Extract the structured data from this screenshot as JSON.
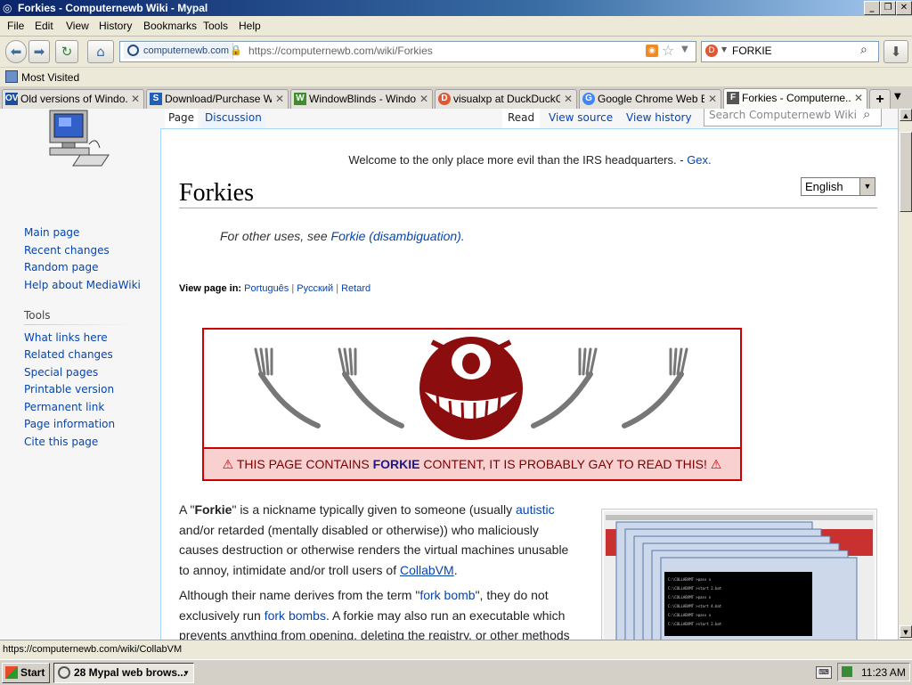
{
  "window": {
    "title": "Forkies - Computernewb Wiki - Mypal"
  },
  "menu": [
    "File",
    "Edit",
    "View",
    "History",
    "Bookmarks",
    "Tools",
    "Help"
  ],
  "nav": {
    "site_identity": "computernewb.com",
    "url": "https://computernewb.com/wiki/Forkies",
    "search_value": "FORKIE"
  },
  "bookmarks": {
    "most_visited": "Most Visited"
  },
  "tabs": [
    {
      "label": "Old versions of Windo...",
      "fav": "OV",
      "color": "#1a4fa0"
    },
    {
      "label": "Download/Purchase W...",
      "fav": "S",
      "color": "#1f5fb8"
    },
    {
      "label": "WindowBlinds - Windo...",
      "fav": "W",
      "color": "#3e8f2a"
    },
    {
      "label": "visualxp at DuckDuckGo",
      "fav": "D",
      "color": "#de5833"
    },
    {
      "label": "Google Chrome Web B...",
      "fav": "G",
      "color": "#4285f4"
    },
    {
      "label": "Forkies - Computerne...",
      "fav": "F",
      "color": "#555555"
    }
  ],
  "sidebar": {
    "nav_items": [
      "Main page",
      "Recent changes",
      "Random page",
      "Help about MediaWiki"
    ],
    "tools_heading": "Tools",
    "tools_items": [
      "What links here",
      "Related changes",
      "Special pages",
      "Printable version",
      "Permanent link",
      "Page information",
      "Cite this page"
    ]
  },
  "page_tabs": {
    "page": "Page",
    "discussion": "Discussion",
    "read": "Read",
    "view_source": "View source",
    "view_history": "View history",
    "search_placeholder": "Search Computernewb Wiki"
  },
  "article": {
    "sitenotice": "Welcome to the only place more evil than the IRS headquarters. -",
    "sitenotice_author": "Gex.",
    "title": "Forkies",
    "language": "English",
    "hatnote_prefix": "For other uses, see",
    "hatnote_link": "Forkie (disambiguation).",
    "view_in_label": "View page in:",
    "view_in_links": [
      "Português",
      "Русский",
      "Retard"
    ],
    "banner": {
      "pre": "THIS PAGE CONTAINS",
      "strong": "FORKIE",
      "post": "CONTENT, IT IS PROBABLY GAY TO READ THIS!"
    },
    "p1": {
      "a": "A \"",
      "b": "Forkie",
      "c": "\" is a nickname typically given to someone (usually",
      "d": "autistic",
      "e": "and/or retarded (mentally disabled or otherwise)) who maliciously causes destruction or otherwise renders the virtual machines unusable to annoy, intimidate and/or troll users of",
      "f": "CollabVM",
      "g": "."
    },
    "p2": {
      "a": "Although their name derives from the term \"",
      "b": "fork bomb",
      "c": "\", they do not exclusively run",
      "d": "fork bombs",
      "e": ". A forkie may also run an executable which prevents anything from opening, deleting the registry, or other methods"
    }
  },
  "status": {
    "hover_url": "https://computernewb.com/wiki/CollabVM"
  },
  "taskbar": {
    "start": "Start",
    "task": "28 Mypal web brows...",
    "clock": "11:23 AM"
  },
  "colors": {
    "link": "#0645ad",
    "banner_border": "#cc0000",
    "banner_bg": "#f8d0d0",
    "mascot": "#8b0d0d"
  }
}
